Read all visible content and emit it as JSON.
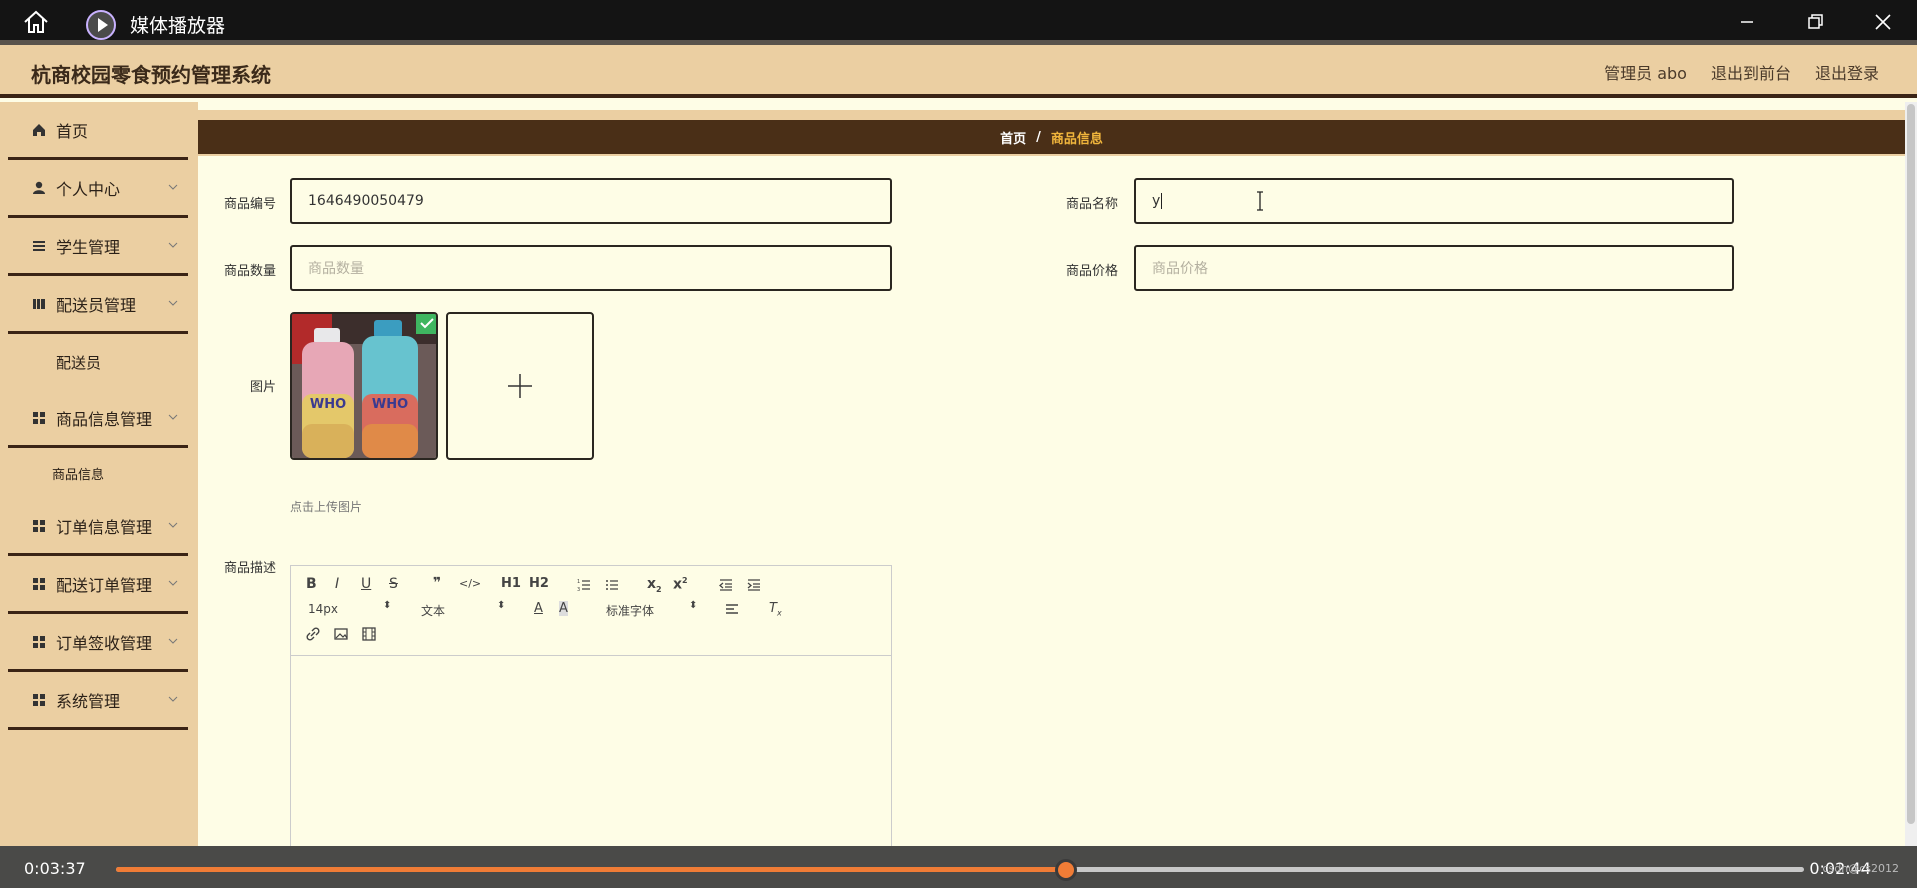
{
  "window": {
    "title": "媒体播放器"
  },
  "header": {
    "system_title": "杭商校园零食预约管理系统",
    "admin_label": "管理员 abo",
    "back_front": "退出到前台",
    "logout": "退出登录"
  },
  "sidebar": {
    "items": [
      {
        "label": "首页"
      },
      {
        "label": "个人中心"
      },
      {
        "label": "学生管理"
      },
      {
        "label": "配送员管理"
      },
      {
        "label": "配送员"
      },
      {
        "label": "商品信息管理"
      },
      {
        "label": "商品信息"
      },
      {
        "label": "订单信息管理"
      },
      {
        "label": "配送订单管理"
      },
      {
        "label": "订单签收管理"
      },
      {
        "label": "系统管理"
      }
    ]
  },
  "breadcrumb": {
    "home": "首页",
    "separator": "/",
    "current": "商品信息"
  },
  "form": {
    "code_label": "商品编号",
    "code_value": "1646490050479",
    "name_label": "商品名称",
    "name_value": "y",
    "qty_label": "商品数量",
    "qty_placeholder": "商品数量",
    "price_label": "商品价格",
    "price_placeholder": "商品价格",
    "image_label": "图片",
    "upload_hint": "点击上传图片",
    "desc_label": "商品描述"
  },
  "editor": {
    "font_size": "14px",
    "text_style": "文本",
    "font_family": "标准字体",
    "h1": "H1",
    "h2": "H2"
  },
  "player": {
    "elapsed": "0:03:37",
    "remaining": "0:02:44",
    "progress": 0.5627,
    "watermark": "csdn@cs2012"
  },
  "colors": {
    "header_bg": "#ebcfa2",
    "dark_brown": "#4a2f17",
    "accent_orange": "#f07c36",
    "content_bg": "#fefde6"
  }
}
